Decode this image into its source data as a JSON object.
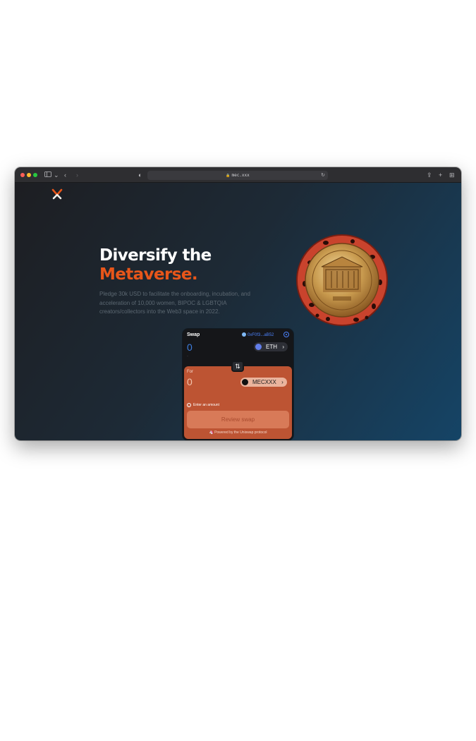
{
  "browser": {
    "url": "mec.xxx",
    "traffic_lights": [
      "close",
      "minimize",
      "zoom"
    ]
  },
  "hero": {
    "title_line1": "Diversify the",
    "title_line2": "Metaverse.",
    "description": "Pledge 30k USD to facilitate the onboarding, incubation, and acceleration of 10,000 women, BIPOC & LGBTQIA creators/collectors into the Web3 space in 2022.",
    "accent_color": "#e8561a"
  },
  "swap": {
    "title": "Swap",
    "wallet": "0xF0f3...aB52",
    "input_amount": "0",
    "input_sub": "-",
    "input_token": "ETH",
    "output_label": "For",
    "output_amount": "0",
    "output_token": "MECXXX",
    "warning": "Enter an amount",
    "button_label": "Review swap",
    "powered_by": "Powered by the Uniswap protocol",
    "output_bg_color": "#bd5433"
  }
}
